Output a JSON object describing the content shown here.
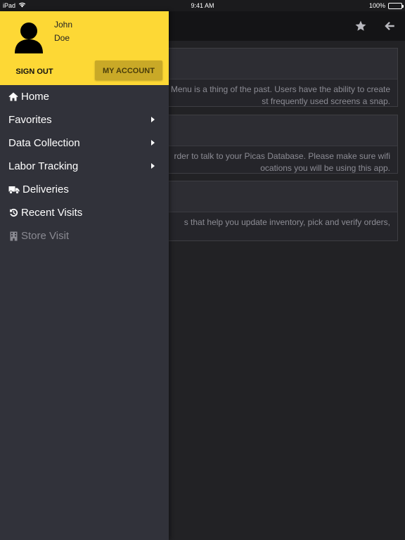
{
  "status_bar": {
    "device": "iPad",
    "time": "9:41 AM",
    "battery": "100%",
    "battery_level": 1.0
  },
  "header": {
    "star_icon": "star-icon",
    "back_icon": "arrow-left-icon"
  },
  "cards": [
    {
      "lines": [
        "Menu is a thing of the past. Users have the ability to create",
        "st frequently used screens a snap."
      ]
    },
    {
      "lines": [
        "rder to talk to your Picas Database. Please make sure wifi",
        "ocations you will be using this app."
      ]
    },
    {
      "lines": [
        "s that help you update inventory, pick and verify orders,"
      ]
    }
  ],
  "drawer": {
    "user": {
      "first_name": "John",
      "last_name": "Doe"
    },
    "sign_out_label": "SIGN OUT",
    "my_account_label": "MY ACCOUNT",
    "accent_color": "#fdd835",
    "menu": [
      {
        "label": "Home",
        "icon": "home-icon"
      },
      {
        "label": "Favorites"
      },
      {
        "label": "Data Collection"
      },
      {
        "label": "Labor Tracking"
      },
      {
        "label": "Deliveries",
        "icon": "truck-icon"
      },
      {
        "label": "Recent Visits",
        "icon": "history-icon"
      },
      {
        "label": "Store Visit",
        "icon": "building-icon",
        "disabled": true
      }
    ]
  }
}
